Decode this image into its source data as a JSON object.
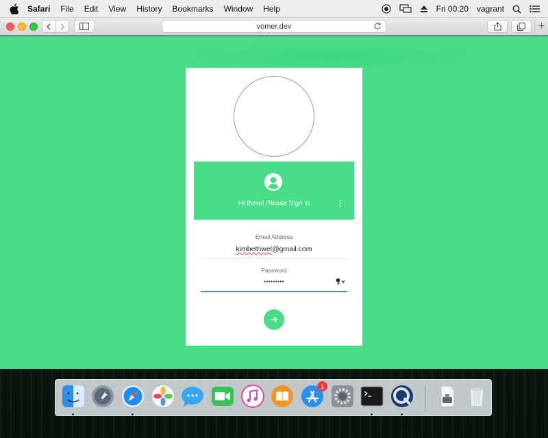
{
  "menubar": {
    "app_name": "Safari",
    "items": [
      "File",
      "Edit",
      "View",
      "History",
      "Bookmarks",
      "Window",
      "Help"
    ],
    "clock": "Fri 00:20",
    "user": "vagrant"
  },
  "browser": {
    "url": "vomer.dev"
  },
  "login": {
    "greeting": "Hi there! Please Sign in",
    "email_label": "Email Address",
    "email_value_plain": "kimbethwel",
    "email_value_suffix": "@gmail.com",
    "password_label": "Password",
    "password_value": "•••••••••"
  },
  "dock": {
    "items": [
      "Finder",
      "Launchpad",
      "Safari",
      "Photos",
      "Messages",
      "FaceTime",
      "iTunes",
      "iBooks",
      "App Store",
      "System Preferences",
      "Terminal",
      "QuickTime Player",
      "Archive",
      "Trash"
    ],
    "app_store_badge": "1"
  },
  "colors": {
    "page_green": "#48dd88",
    "input_focus": "#3b8fd6",
    "badge_red": "#f23a3a"
  }
}
